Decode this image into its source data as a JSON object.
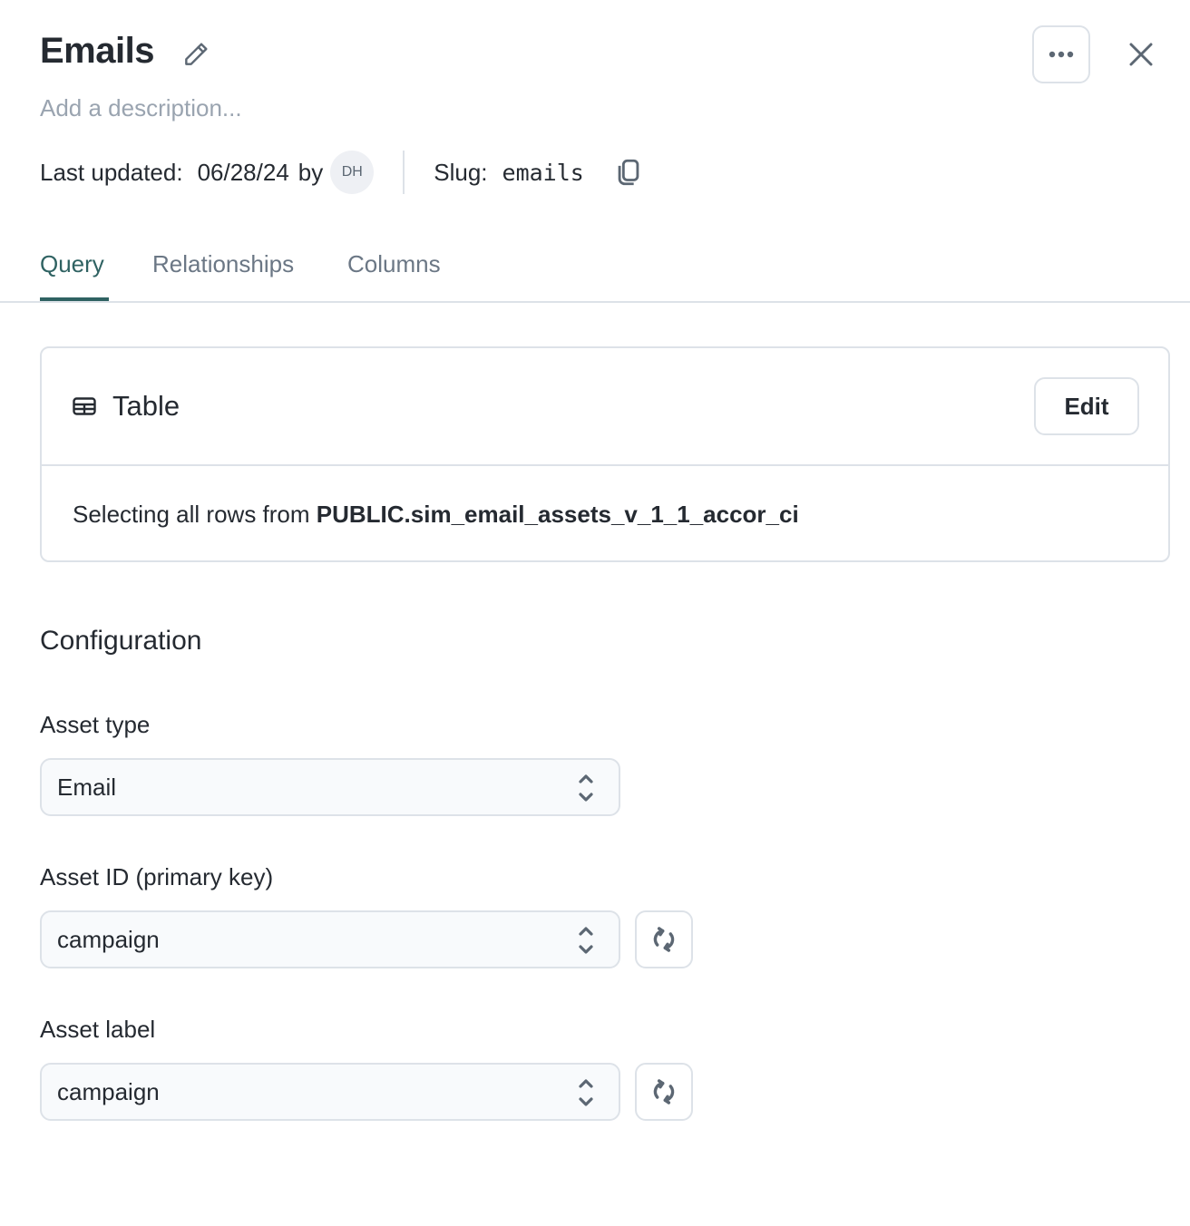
{
  "header": {
    "title": "Emails",
    "description_placeholder": "Add a description...",
    "more_icon": "ellipsis-icon",
    "close_icon": "close-icon",
    "edit_icon": "pencil-icon"
  },
  "meta": {
    "last_updated_label": "Last updated:",
    "last_updated_date": "06/28/24",
    "by_label": "by",
    "avatar_initials": "DH",
    "slug_label": "Slug:",
    "slug_value": "emails",
    "copy_icon": "copy-icon"
  },
  "tabs": [
    {
      "label": "Query",
      "active": true
    },
    {
      "label": "Relationships",
      "active": false
    },
    {
      "label": "Columns",
      "active": false
    }
  ],
  "query_card": {
    "icon": "table-icon",
    "title": "Table",
    "edit_label": "Edit",
    "body_prefix": "Selecting all rows from",
    "table_name": "PUBLIC.sim_email_assets_v_1_1_accor_ci"
  },
  "configuration": {
    "title": "Configuration",
    "fields": [
      {
        "label": "Asset type",
        "value": "Email",
        "has_sync": false
      },
      {
        "label": "Asset ID (primary key)",
        "value": "campaign",
        "has_sync": true
      },
      {
        "label": "Asset label",
        "value": "campaign",
        "has_sync": true
      }
    ]
  },
  "colors": {
    "accent": "#2f6262",
    "text": "#252a31",
    "muted": "#9aa4b0",
    "border": "#dde2e8"
  }
}
